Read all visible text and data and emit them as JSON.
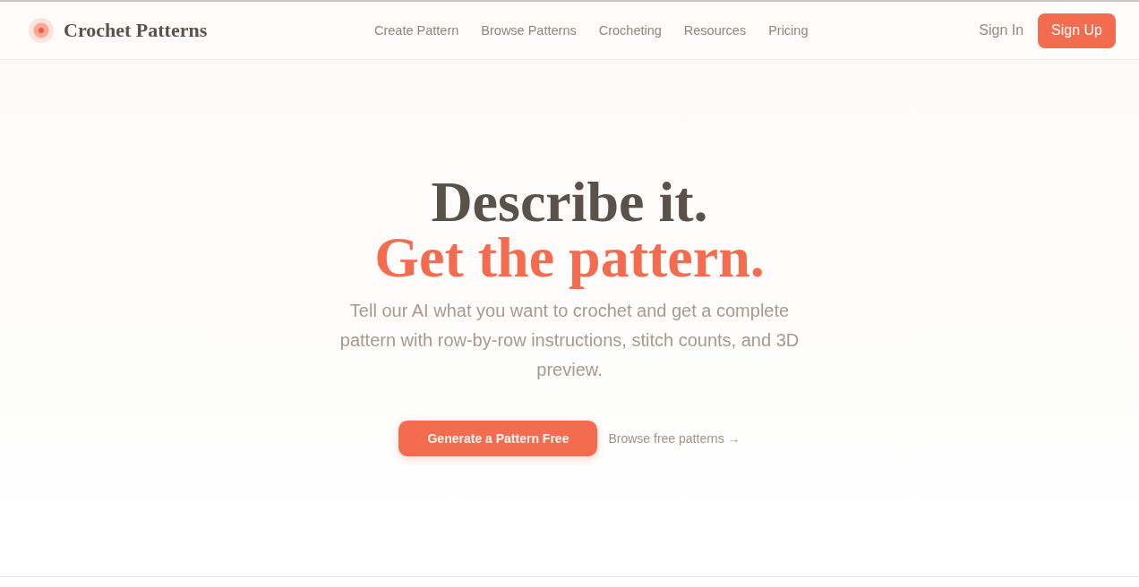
{
  "header": {
    "brand": "Crochet Patterns",
    "nav": [
      "Create Pattern",
      "Browse Patterns",
      "Crocheting",
      "Resources",
      "Pricing"
    ],
    "sign_in": "Sign In",
    "sign_up": "Sign Up"
  },
  "hero": {
    "title_line_1": "Describe it.",
    "title_line_2": "Get the pattern.",
    "subtitle": "Tell our AI what you want to crochet and get a complete pattern with row-by-row instructions, stitch counts, and 3D preview.",
    "primary_button": "Generate a Pattern Free",
    "secondary_link": "Browse free patterns →"
  }
}
